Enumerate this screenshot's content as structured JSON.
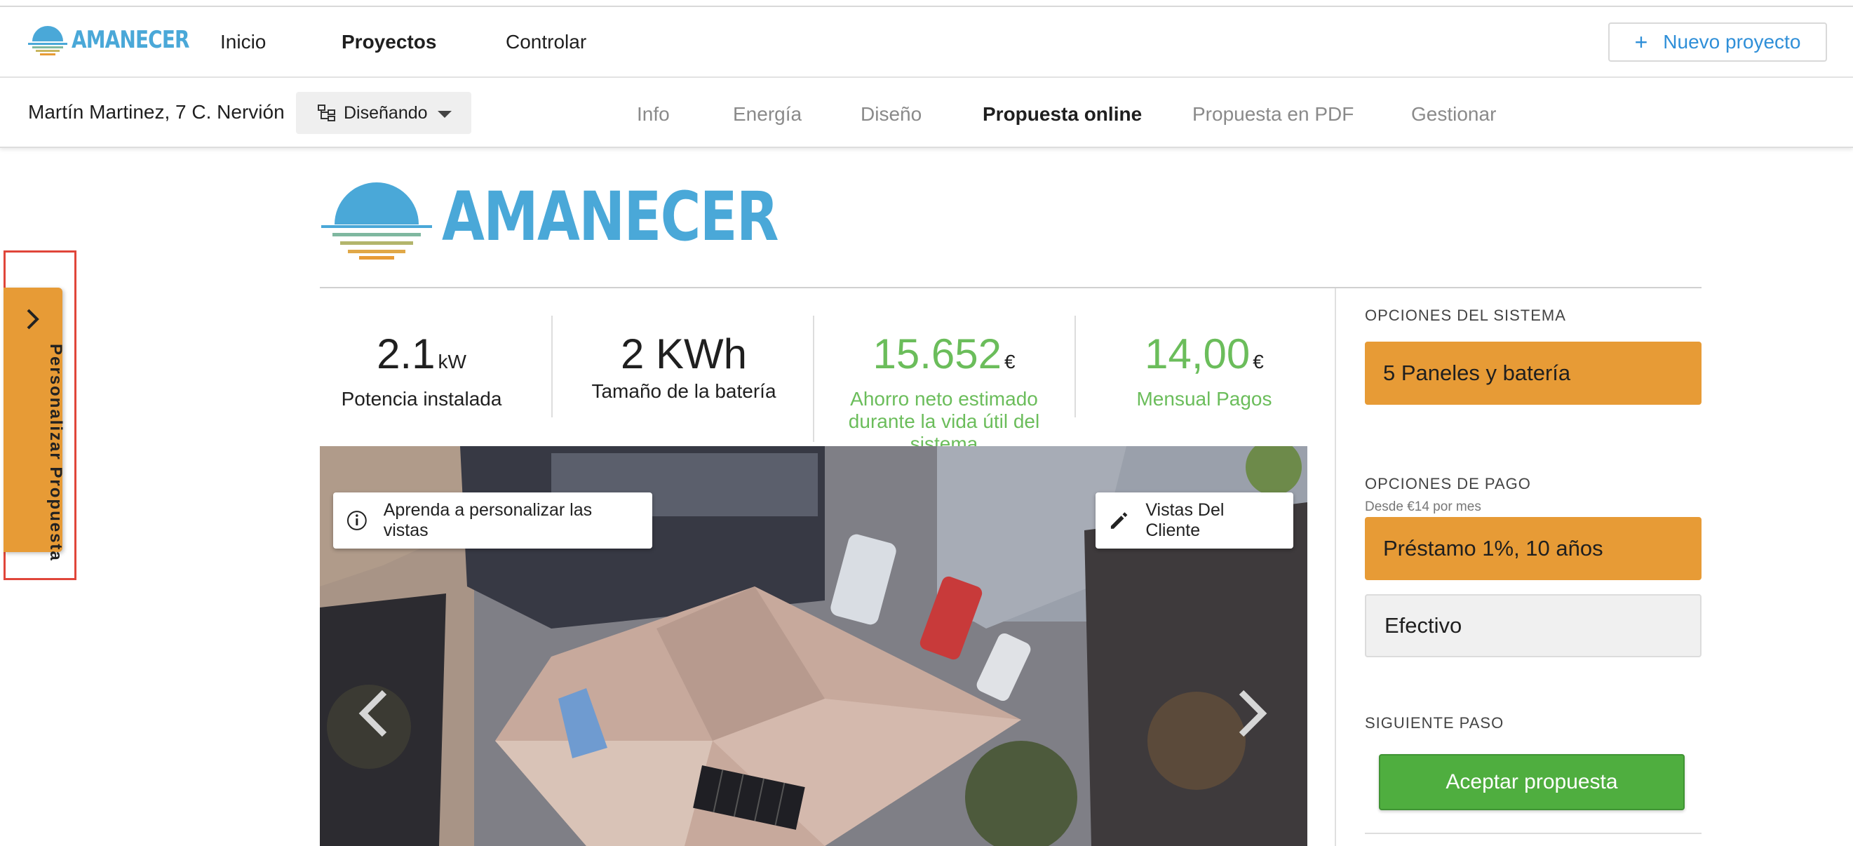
{
  "header": {
    "brand": "AMANECER",
    "nav": [
      "Inicio",
      "Proyectos",
      "Controlar"
    ],
    "active_nav": "Proyectos",
    "new_project": "Nuevo proyecto"
  },
  "project_bar": {
    "address": "Martín Martinez, 7 C. Nervión",
    "status": "Diseñando",
    "tabs": [
      "Info",
      "Energía",
      "Diseño",
      "Propuesta online",
      "Propuesta en PDF",
      "Gestionar"
    ],
    "active_tab": "Propuesta online"
  },
  "side_tab": {
    "label": "Personalizar Propuesta"
  },
  "proposal": {
    "brand": "AMANECER",
    "stats": [
      {
        "value": "2.1",
        "unit": "kW",
        "label": "Potencia instalada"
      },
      {
        "value": "2 KWh",
        "unit": "",
        "label": "Tamaño de la batería"
      },
      {
        "value": "15.652",
        "unit": "€",
        "label": "Ahorro neto estimado durante la vida útil del sistema"
      },
      {
        "value": "14,00",
        "unit": "€",
        "label": "Mensual Pagos"
      }
    ],
    "learn_views": "Aprenda a personalizar las vistas",
    "client_views": "Vistas Del Cliente"
  },
  "right_panel": {
    "system_options_title": "OPCIONES DEL SISTEMA",
    "system_option": "5 Paneles y batería",
    "payment_options_title": "OPCIONES DE PAGO",
    "payment_subtitle": "Desde €14 por mes",
    "payment_options": [
      "Préstamo 1%, 10 años",
      "Efectivo"
    ],
    "next_step_title": "SIGUIENTE PASO",
    "accept_button": "Aceptar propuesta"
  },
  "colors": {
    "brand_blue": "#4aa8d8",
    "orange": "#e79b36",
    "green": "#6bbd5b",
    "accept_green": "#4fae3f",
    "highlight_red": "#e0463a"
  }
}
